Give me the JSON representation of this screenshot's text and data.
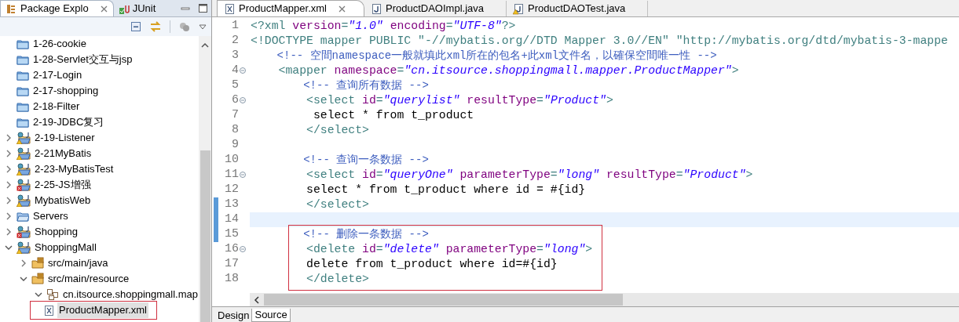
{
  "explorer": {
    "tabs": [
      {
        "label": "Package Explo",
        "selected": true,
        "closable": true,
        "kind": "hierarchy"
      },
      {
        "label": "JUnit",
        "selected": false,
        "closable": false,
        "kind": "junit"
      }
    ],
    "tree": [
      {
        "label": "1-26-cookie",
        "kind": "folder",
        "selected": false
      },
      {
        "label": "1-28-Servlet交互与jsp",
        "kind": "folder",
        "selected": false
      },
      {
        "label": "2-17-Login",
        "kind": "folder",
        "selected": false
      },
      {
        "label": "2-17-shopping",
        "kind": "folder",
        "selected": false
      },
      {
        "label": "2-18-Filter",
        "kind": "folder",
        "selected": false
      },
      {
        "label": "2-19-JDBC复习",
        "kind": "folder",
        "selected": false
      },
      {
        "label": "2-19-Listener",
        "kind": "project-warning",
        "expanded": false,
        "selected": false
      },
      {
        "label": "2-21MyBatis",
        "kind": "project-warning",
        "expanded": false,
        "selected": false
      },
      {
        "label": "2-23-MyBatisTest",
        "kind": "project-warning",
        "expanded": false,
        "selected": false
      },
      {
        "label": "2-25-JS增强",
        "kind": "project-error",
        "expanded": false,
        "selected": false
      },
      {
        "label": "MybatisWeb",
        "kind": "project-warning",
        "expanded": false,
        "selected": false
      },
      {
        "label": "Servers",
        "kind": "servers",
        "expanded": false,
        "selected": false
      },
      {
        "label": "Shopping",
        "kind": "project-error",
        "expanded": false,
        "selected": false
      },
      {
        "label": "ShoppingMall",
        "kind": "project-warning",
        "expanded": true,
        "selected": false,
        "children": [
          {
            "label": "src/main/java",
            "kind": "source-folder",
            "expanded": false,
            "selected": false
          },
          {
            "label": "src/main/resource",
            "kind": "source-folder",
            "expanded": true,
            "selected": false,
            "children": [
              {
                "label": "cn.itsource.shoppingmall.map",
                "kind": "package",
                "expanded": true,
                "selected": false,
                "children": [
                  {
                    "label": "ProductMapper.xml",
                    "kind": "xml-file",
                    "selected": true,
                    "boxed": true
                  }
                ]
              }
            ]
          }
        ]
      }
    ]
  },
  "editor": {
    "tabs": [
      {
        "label": "ProductMapper.xml",
        "selected": true,
        "closable": true,
        "kind": "xml-file"
      },
      {
        "label": "ProductDAOImpl.java",
        "selected": false,
        "closable": false,
        "kind": "java-file"
      },
      {
        "label": "ProductDAOTest.java",
        "selected": false,
        "closable": false,
        "kind": "java-file-warning"
      }
    ],
    "lines": [
      {
        "number": "1",
        "tokens": [
          {
            "kind": "tag",
            "text": "<?xml "
          },
          {
            "kind": "attr",
            "text": "version"
          },
          {
            "kind": "tag",
            "text": "="
          },
          {
            "kind": "value",
            "text": "\"1.0\""
          },
          {
            "kind": "attr",
            "text": " encoding"
          },
          {
            "kind": "tag",
            "text": "="
          },
          {
            "kind": "value",
            "text": "\"UTF-8\""
          },
          {
            "kind": "tag",
            "text": "?>"
          }
        ]
      },
      {
        "number": "2",
        "tokens": [
          {
            "kind": "tag",
            "text": "<!DOCTYPE mapper PUBLIC \"-//mybatis.org//DTD Mapper 3.0//EN\" \"http://mybatis.org/dtd/mybatis-3-mappe"
          }
        ]
      },
      {
        "number": "3",
        "tokens": [
          {
            "kind": "comment",
            "text": "    <!-- 空間namespace一般就填此xml所在的包名+此xml文件名，以確保空間唯一性 -->"
          }
        ]
      },
      {
        "number": "4",
        "foldable": true,
        "tokens": [
          {
            "kind": "tag",
            "text": "    <mapper "
          },
          {
            "kind": "attr",
            "text": "namespace"
          },
          {
            "kind": "tag",
            "text": "="
          },
          {
            "kind": "value",
            "text": "\"cn.itsource.shoppingmall.mapper.ProductMapper\""
          },
          {
            "kind": "tag",
            "text": ">"
          }
        ]
      },
      {
        "number": "5",
        "tokens": [
          {
            "kind": "comment",
            "text": "        <!-- 查询所有数据 -->"
          }
        ]
      },
      {
        "number": "6",
        "foldable": true,
        "tokens": [
          {
            "kind": "tag",
            "text": "        <select "
          },
          {
            "kind": "attr",
            "text": "id"
          },
          {
            "kind": "tag",
            "text": "="
          },
          {
            "kind": "value",
            "text": "\"querylist\""
          },
          {
            "kind": "attr",
            "text": " resultType"
          },
          {
            "kind": "tag",
            "text": "="
          },
          {
            "kind": "value",
            "text": "\"Product\""
          },
          {
            "kind": "tag",
            "text": ">"
          }
        ]
      },
      {
        "number": "7",
        "tokens": [
          {
            "kind": "text",
            "text": "         select * from t_product"
          }
        ]
      },
      {
        "number": "8",
        "tokens": [
          {
            "kind": "tag",
            "text": "        </select>"
          }
        ]
      },
      {
        "number": "9"
      },
      {
        "number": "10",
        "tokens": [
          {
            "kind": "comment",
            "text": "        <!-- 查询一条数据 -->"
          }
        ]
      },
      {
        "number": "11",
        "foldable": true,
        "tokens": [
          {
            "kind": "tag",
            "text": "        <select "
          },
          {
            "kind": "attr",
            "text": "id"
          },
          {
            "kind": "tag",
            "text": "="
          },
          {
            "kind": "value",
            "text": "\"queryOne\""
          },
          {
            "kind": "attr",
            "text": " parameterType"
          },
          {
            "kind": "tag",
            "text": "="
          },
          {
            "kind": "value",
            "text": "\"long\""
          },
          {
            "kind": "attr",
            "text": " resultType"
          },
          {
            "kind": "tag",
            "text": "="
          },
          {
            "kind": "value",
            "text": "\"Product\""
          },
          {
            "kind": "tag",
            "text": ">"
          }
        ]
      },
      {
        "number": "12",
        "tokens": [
          {
            "kind": "text",
            "text": "        select * from t_product where id = #{id}"
          }
        ]
      },
      {
        "number": "13",
        "changed": true,
        "tokens": [
          {
            "kind": "tag",
            "text": "        </select>"
          }
        ]
      },
      {
        "number": "14",
        "changed": true,
        "current": true
      },
      {
        "number": "15",
        "changed": true,
        "boxed": true,
        "tokens": [
          {
            "kind": "comment",
            "text": "        <!-- 删除一条数据 -->"
          }
        ]
      },
      {
        "number": "16",
        "foldable": true,
        "boxed": true,
        "tokens": [
          {
            "kind": "tag",
            "text": "        <delete "
          },
          {
            "kind": "attr",
            "text": "id"
          },
          {
            "kind": "tag",
            "text": "="
          },
          {
            "kind": "value",
            "text": "\"delete\""
          },
          {
            "kind": "attr",
            "text": " parameterType"
          },
          {
            "kind": "tag",
            "text": "="
          },
          {
            "kind": "value",
            "text": "\"long\""
          },
          {
            "kind": "tag",
            "text": ">"
          }
        ]
      },
      {
        "number": "17",
        "boxed": true,
        "tokens": [
          {
            "kind": "text",
            "text": "        delete from t_product where id=#{id}"
          }
        ]
      },
      {
        "number": "18",
        "boxed": true,
        "tokens": [
          {
            "kind": "tag",
            "text": "        </delete>"
          }
        ]
      }
    ],
    "bottom_tabs": [
      {
        "label": "Design",
        "selected": false
      },
      {
        "label": "Source",
        "selected": true
      }
    ]
  }
}
